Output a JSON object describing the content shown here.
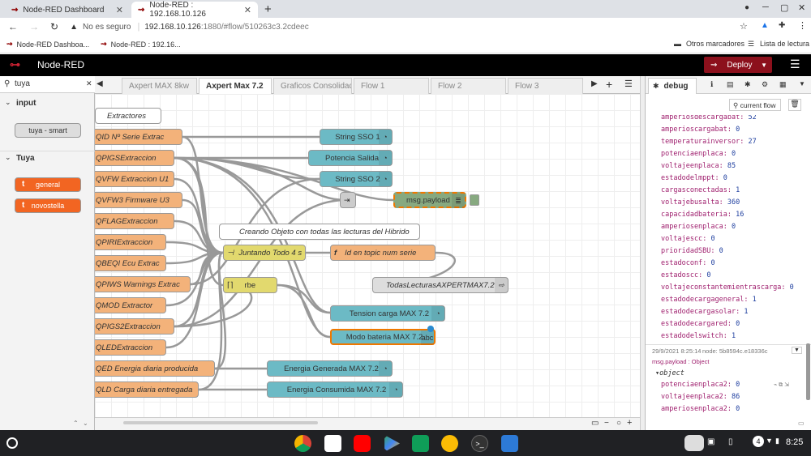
{
  "browser": {
    "tabs": [
      {
        "title": "Node-RED Dashboard",
        "active": false
      },
      {
        "title": "Node-RED : 192.168.10.126",
        "active": true
      }
    ],
    "new_tab": "+",
    "security": "No es seguro",
    "url_host": "192.168.10.126",
    "url_rest": ":1880/#flow/510263c3.2cdeec",
    "bookmarks": [
      "Node-RED Dashboa...",
      "Node-RED : 192.16..."
    ],
    "other_bookmarks": "Otros marcadores",
    "reading_list": "Lista de lectura"
  },
  "header": {
    "title": "Node-RED",
    "deploy": "Deploy"
  },
  "palette": {
    "search": "tuya",
    "categories": [
      {
        "name": "input",
        "nodes": [
          "tuya - smart"
        ]
      },
      {
        "name": "Tuya",
        "nodes": [
          "general",
          "novostella"
        ]
      }
    ]
  },
  "workspace_tabs": [
    "Axpert MAX 8kw",
    "Axpert Max 7.2",
    "Graficos Consolidad",
    "Flow 1",
    "Flow 2",
    "Flow 3"
  ],
  "active_workspace_tab": "Axpert Max 7.2",
  "flow_nodes": {
    "comment1": "Extractores",
    "comment2": "Creando Objeto con todas las lecturas del Hibrido",
    "extractors": [
      "QID Nº Serie Extrac",
      "QPIGSExtraccion",
      "QVFW Extraccion U1",
      "QVFW3 Firmware U3",
      "QFLAGExtraccion",
      "QPIRIExtraccion",
      "QBEQI Ecu Extrac",
      "QPIWS Warnings Extrac",
      "QMOD Extractor",
      "QPIGS2Extraccion",
      "QLEDExtraccion",
      "QED Energia diaria producida",
      "QLD Carga diaria entregada"
    ],
    "string1": "String SSO 1",
    "potencia": "Potencia Salida",
    "string2": "String SSO 2",
    "msgpayload": "msg.payload",
    "juntando": "Juntando Todo 4 s",
    "idtopic": "Id en topic num serie",
    "todas": "TodasLecturasAXPERTMAX7.2",
    "rbe": "rbe",
    "tension": "Tension carga MAX 7.2",
    "modo": "Modo bateria MAX 7.2",
    "energiagen": "Energia Generada MAX 7.2",
    "energiacon": "Energia Consumida MAX 7.2"
  },
  "sidebar": {
    "tab": "debug",
    "filter": "current flow",
    "rows1": [
      [
        "amperiosdescargabat",
        "52"
      ],
      [
        "amperioscargabat",
        "0"
      ],
      [
        "temperaturainversor",
        "27"
      ],
      [
        "potenciaenplaca",
        "0"
      ],
      [
        "voltajeenplaca",
        "85"
      ],
      [
        "estadodelmppt",
        "0"
      ],
      [
        "cargasconectadas",
        "1"
      ],
      [
        "voltajebusalta",
        "360"
      ],
      [
        "capacidadbateria",
        "16"
      ],
      [
        "amperiosenplaca",
        "0"
      ],
      [
        "voltajescc",
        "0"
      ],
      [
        "prioridadSBU",
        "0"
      ],
      [
        "estadoconf",
        "0"
      ],
      [
        "estadoscc",
        "0"
      ],
      [
        "voltajeconstantemientrascarga",
        "0"
      ],
      [
        "estadodecargageneral",
        "1"
      ],
      [
        "estadodecargasolar",
        "1"
      ],
      [
        "estadodecargared",
        "0"
      ],
      [
        "estadodelswitch",
        "1"
      ]
    ],
    "msg_time": "29/9/2021 8:25:14",
    "msg_node": "node: 5b8594c.e18336c",
    "msg_topic": "msg.payload : Object",
    "object_label": "object",
    "rows2": [
      [
        "potenciaenplaca2",
        "0"
      ],
      [
        "voltajeenplaca2",
        "86"
      ],
      [
        "amperiosenplaca2",
        "0"
      ]
    ]
  },
  "taskbar": {
    "time": "8:25",
    "badge": "4"
  }
}
